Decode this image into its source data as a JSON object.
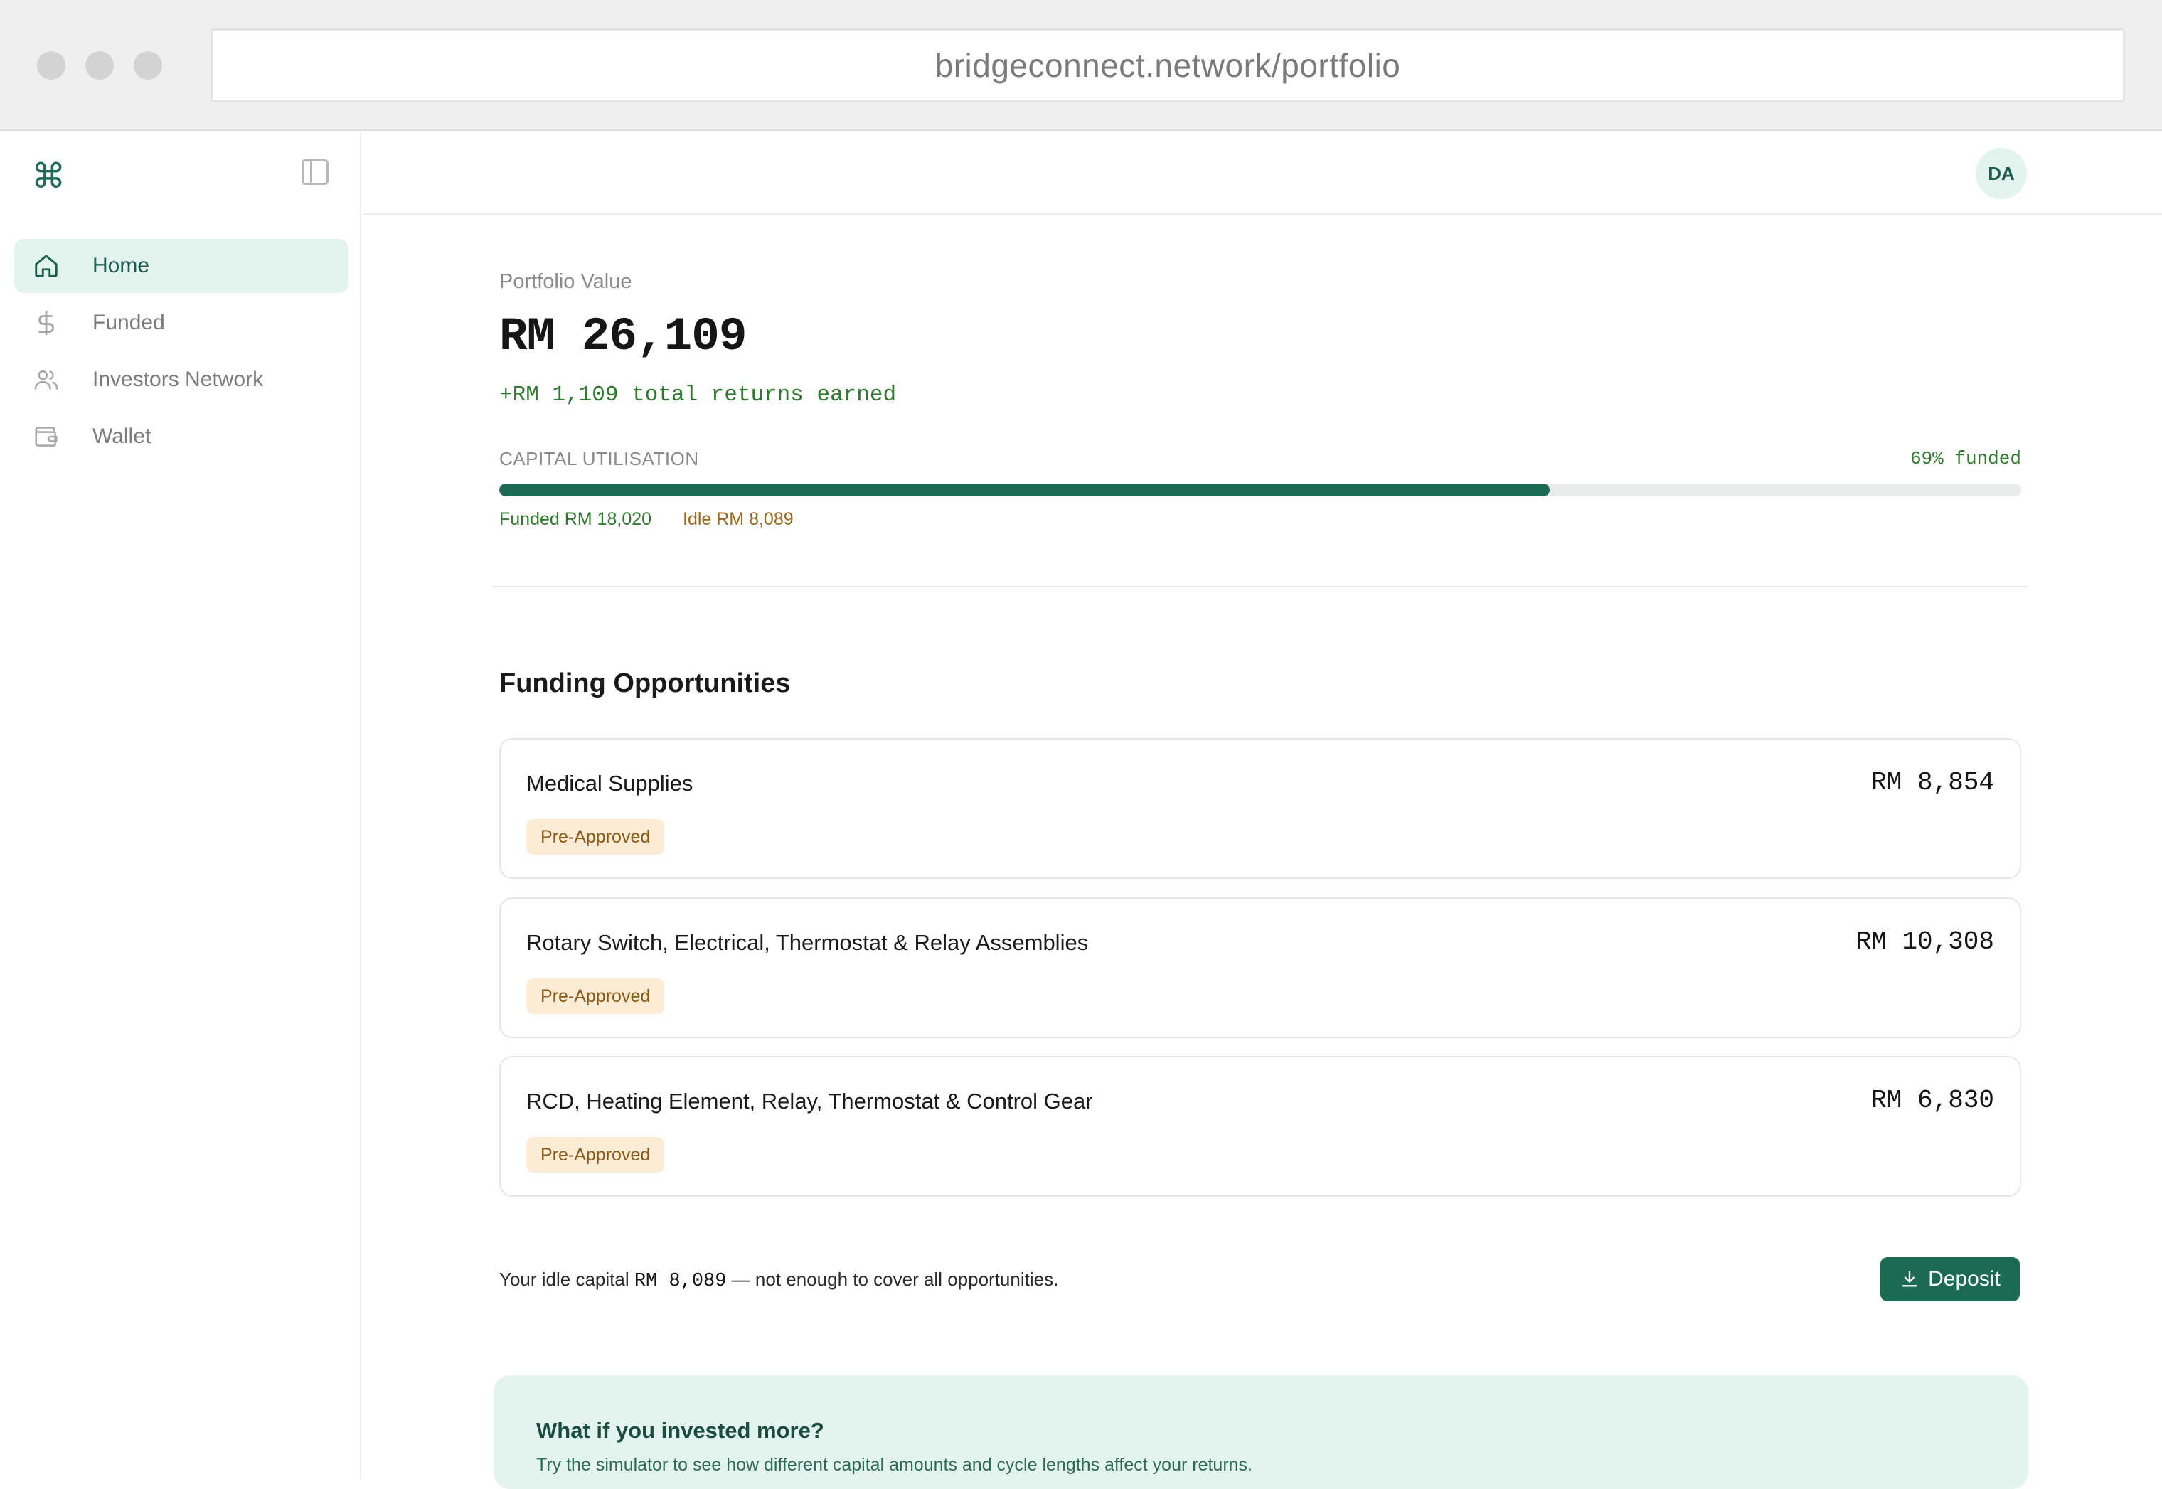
{
  "browser": {
    "url": "bridgeconnect.network/portfolio"
  },
  "sidebar": {
    "logo_icon": "command-icon",
    "items": [
      {
        "label": "Home",
        "icon": "home-icon",
        "active": true
      },
      {
        "label": "Funded",
        "icon": "dollar-icon",
        "active": false
      },
      {
        "label": "Investors Network",
        "icon": "users-icon",
        "active": false
      },
      {
        "label": "Wallet",
        "icon": "wallet-icon",
        "active": false
      }
    ]
  },
  "header": {
    "avatar_initials": "DA"
  },
  "portfolio": {
    "label": "Portfolio Value",
    "value": "RM 26,109",
    "returns": "+RM 1,109 total returns earned"
  },
  "capital": {
    "label": "CAPITAL UTILISATION",
    "percent_text": "69% funded",
    "funded_fraction": 0.69,
    "funded_text": "Funded RM 18,020",
    "idle_text": "Idle RM 8,089"
  },
  "opportunities": {
    "title": "Funding Opportunities",
    "items": [
      {
        "name": "Medical Supplies",
        "amount": "RM 8,854",
        "status": "Pre-Approved"
      },
      {
        "name": "Rotary Switch, Electrical, Thermostat & Relay Assemblies",
        "amount": "RM 10,308",
        "status": "Pre-Approved"
      },
      {
        "name": "RCD, Heating Element, Relay, Thermostat & Control Gear",
        "amount": "RM 6,830",
        "status": "Pre-Approved"
      }
    ]
  },
  "idle_note": {
    "prefix": "Your idle capital ",
    "amount": "RM 8,089",
    "suffix": " — not enough to cover all opportunities."
  },
  "deposit_button": {
    "label": "Deposit",
    "icon": "download-icon"
  },
  "simulator": {
    "title": "What if you invested more?",
    "text": "Try the simulator to see how different capital amounts and cycle lengths affect your returns."
  },
  "colors": {
    "accent": "#1b6b53",
    "accent_light": "#e3f3ee",
    "positive": "#2f7a2f",
    "badge_bg": "#fcebd5",
    "badge_text": "#8a5a16"
  }
}
